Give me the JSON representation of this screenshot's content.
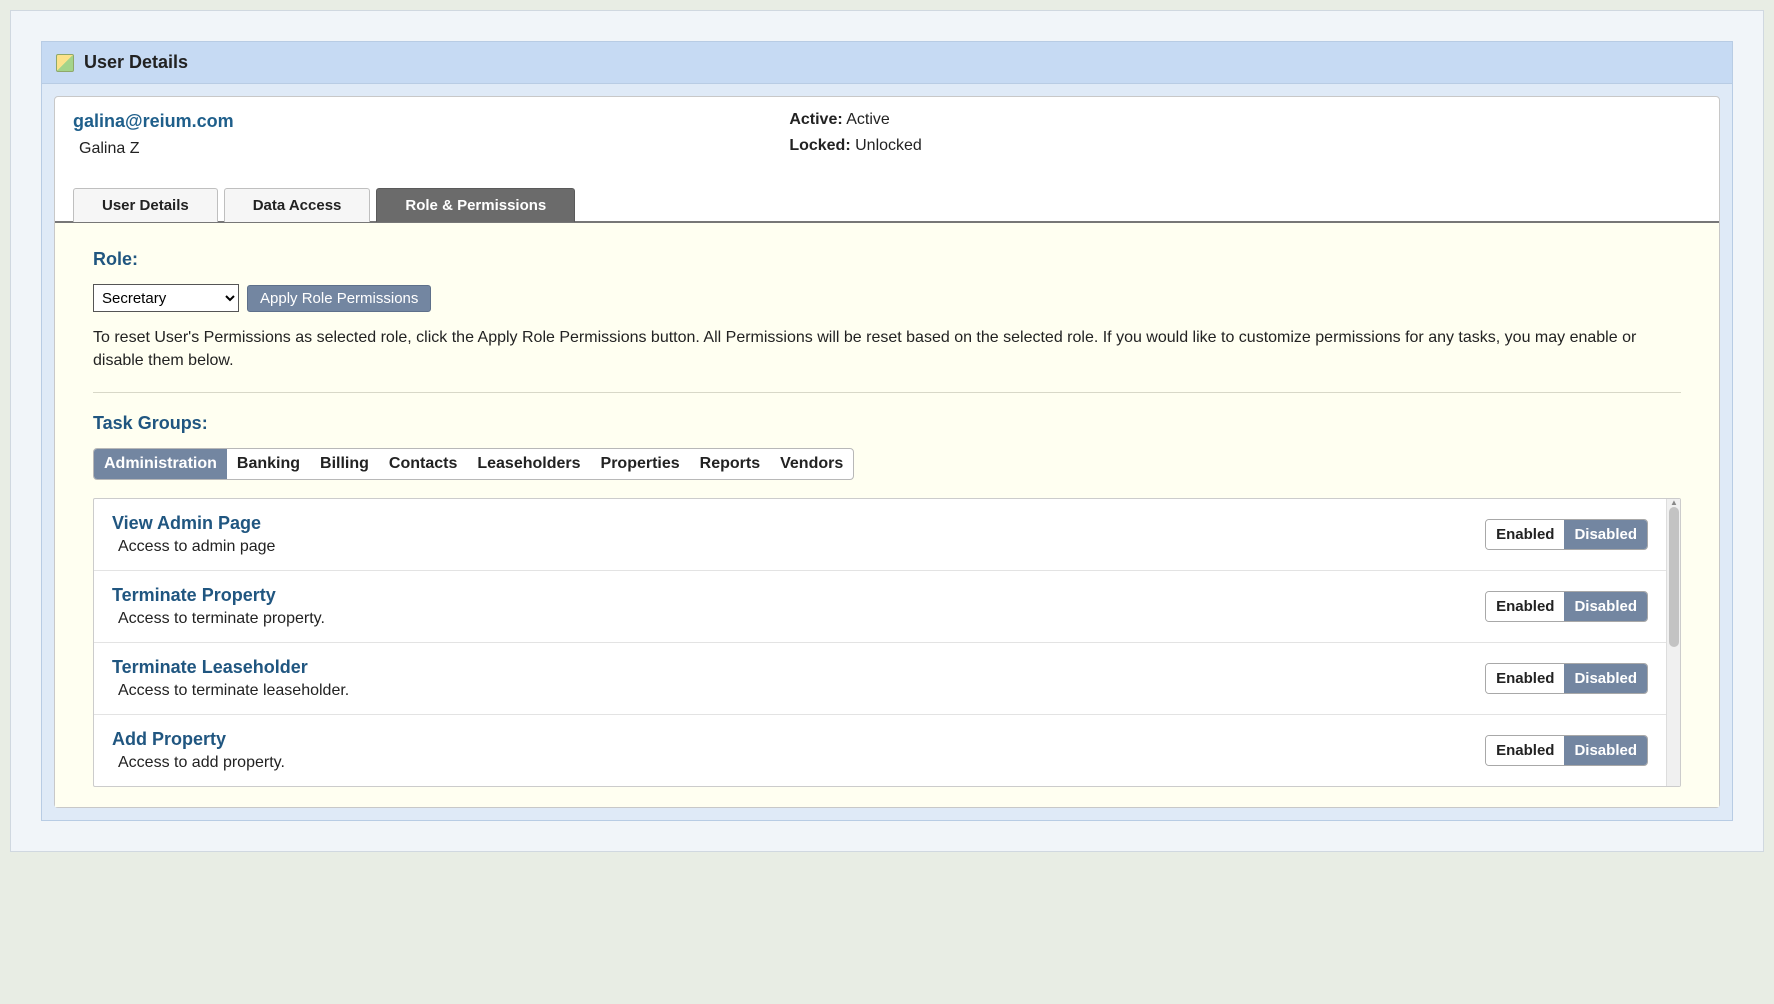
{
  "panel": {
    "title": "User Details"
  },
  "user": {
    "email": "galina@reium.com",
    "name": "Galina Z",
    "active_label": "Active:",
    "active_value": "Active",
    "locked_label": "Locked:",
    "locked_value": "Unlocked"
  },
  "tabs": [
    {
      "label": "User Details",
      "active": false
    },
    {
      "label": "Data Access",
      "active": false
    },
    {
      "label": "Role & Permissions",
      "active": true
    }
  ],
  "role": {
    "heading": "Role:",
    "selected": "Secretary",
    "apply_label": "Apply Role Permissions",
    "help": "To reset User's Permissions as selected role, click the Apply Role Permissions button. All Permissions will be reset based on the selected role. If you would like to customize permissions for any tasks, you may enable or disable them below."
  },
  "task_groups": {
    "heading": "Task Groups:",
    "tabs": [
      {
        "label": "Administration",
        "active": true
      },
      {
        "label": "Banking",
        "active": false
      },
      {
        "label": "Billing",
        "active": false
      },
      {
        "label": "Contacts",
        "active": false
      },
      {
        "label": "Leaseholders",
        "active": false
      },
      {
        "label": "Properties",
        "active": false
      },
      {
        "label": "Reports",
        "active": false
      },
      {
        "label": "Vendors",
        "active": false
      }
    ]
  },
  "toggle_labels": {
    "enabled": "Enabled",
    "disabled": "Disabled"
  },
  "tasks": [
    {
      "title": "View Admin Page",
      "desc": "Access to admin page",
      "state": "disabled"
    },
    {
      "title": "Terminate Property",
      "desc": "Access to terminate property.",
      "state": "disabled"
    },
    {
      "title": "Terminate Leaseholder",
      "desc": "Access to terminate leaseholder.",
      "state": "disabled"
    },
    {
      "title": "Add Property",
      "desc": "Access to add property.",
      "state": "disabled"
    }
  ]
}
